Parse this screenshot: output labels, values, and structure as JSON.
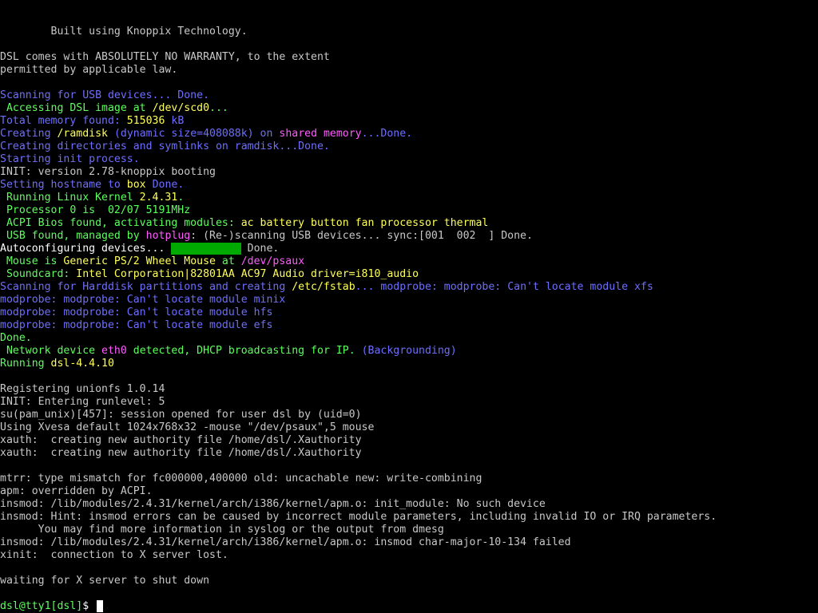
{
  "terminal": {
    "lines": [
      [
        {
          "t": "        Built using Knoppix Technology.",
          "c": "white"
        }
      ],
      [],
      [
        {
          "t": "DSL comes with ABSOLUTELY NO WARRANTY, to the extent",
          "c": "white"
        }
      ],
      [
        {
          "t": "permitted by applicable law.",
          "c": "white"
        }
      ],
      [],
      [
        {
          "t": "Scanning for USB devices... Done.",
          "c": "blue"
        }
      ],
      [
        {
          "t": " Accessing DSL image at ",
          "c": "green"
        },
        {
          "t": "/dev/scd0",
          "c": "yellow"
        },
        {
          "t": "...",
          "c": "green"
        }
      ],
      [
        {
          "t": "Total memory found: ",
          "c": "blue"
        },
        {
          "t": "515036",
          "c": "yellow"
        },
        {
          "t": " kB",
          "c": "blue"
        }
      ],
      [
        {
          "t": "Creating ",
          "c": "blue"
        },
        {
          "t": "/ramdisk",
          "c": "yellow"
        },
        {
          "t": " (dynamic size=408088k) on ",
          "c": "blue"
        },
        {
          "t": "shared memory",
          "c": "magenta"
        },
        {
          "t": "...Done.",
          "c": "blue"
        }
      ],
      [
        {
          "t": "Creating directories and symlinks on ramdisk...Done.",
          "c": "blue"
        }
      ],
      [
        {
          "t": "Starting init process.",
          "c": "blue"
        }
      ],
      [
        {
          "t": "INIT: version 2.78-knoppix booting",
          "c": "white"
        }
      ],
      [
        {
          "t": "Setting hostname to ",
          "c": "blue"
        },
        {
          "t": "box",
          "c": "yellow"
        },
        {
          "t": " Done.",
          "c": "blue"
        }
      ],
      [
        {
          "t": " Running Linux Kernel ",
          "c": "green"
        },
        {
          "t": "2.4.31",
          "c": "yellow"
        },
        {
          "t": ".",
          "c": "green"
        }
      ],
      [
        {
          "t": " Processor 0 is  02/07 5191MHz",
          "c": "green"
        }
      ],
      [
        {
          "t": " ACPI Bios found, activating modules: ",
          "c": "green"
        },
        {
          "t": "ac battery button fan processor thermal",
          "c": "yellow"
        }
      ],
      [
        {
          "t": " USB found, managed by ",
          "c": "green"
        },
        {
          "t": "hotplug",
          "c": "magenta"
        },
        {
          "t": ": (Re-)scanning USB devices... sync:[001  002  ] Done.",
          "c": "white"
        }
      ],
      [
        {
          "t": "Autoconfiguring devices... ",
          "c": "bright"
        },
        {
          "t": "           ",
          "c": "bar"
        },
        {
          "t": " Done.",
          "c": "white"
        }
      ],
      [
        {
          "t": " Mouse is ",
          "c": "green"
        },
        {
          "t": "Generic PS/2 Wheel Mouse",
          "c": "yellow"
        },
        {
          "t": " at ",
          "c": "green"
        },
        {
          "t": "/dev/psaux",
          "c": "magenta"
        }
      ],
      [
        {
          "t": " Soundcard: ",
          "c": "green"
        },
        {
          "t": "Intel Corporation|82801AA AC97 Audio driver=i810_audio",
          "c": "yellow"
        }
      ],
      [
        {
          "t": "Scanning for Harddisk partitions and creating ",
          "c": "blue"
        },
        {
          "t": "/etc/fstab",
          "c": "yellow"
        },
        {
          "t": "... modprobe: modprobe: Can't locate module xfs",
          "c": "blue"
        }
      ],
      [
        {
          "t": "modprobe: modprobe: Can't locate module minix",
          "c": "blue"
        }
      ],
      [
        {
          "t": "modprobe: modprobe: Can't locate module hfs",
          "c": "blue"
        }
      ],
      [
        {
          "t": "modprobe: modprobe: Can't locate module efs",
          "c": "blue"
        }
      ],
      [
        {
          "t": "Done.",
          "c": "green"
        }
      ],
      [
        {
          "t": " Network device ",
          "c": "green"
        },
        {
          "t": "eth0",
          "c": "magenta"
        },
        {
          "t": " detected, DHCP broadcasting for IP. ",
          "c": "green"
        },
        {
          "t": "(Backgrounding)",
          "c": "blue"
        }
      ],
      [
        {
          "t": "Running ",
          "c": "green"
        },
        {
          "t": "dsl-4.4.10",
          "c": "yellow"
        }
      ],
      [],
      [
        {
          "t": "Registering unionfs 1.0.14",
          "c": "white"
        }
      ],
      [
        {
          "t": "INIT: Entering runlevel: 5",
          "c": "white"
        }
      ],
      [
        {
          "t": "su(pam_unix)[457]: session opened for user dsl by (uid=0)",
          "c": "white"
        }
      ],
      [
        {
          "t": "Using Xvesa default 1024x768x32 -mouse \"/dev/psaux\",5 mouse",
          "c": "white"
        }
      ],
      [
        {
          "t": "xauth:  creating new authority file /home/dsl/.Xauthority",
          "c": "white"
        }
      ],
      [
        {
          "t": "xauth:  creating new authority file /home/dsl/.Xauthority",
          "c": "white"
        }
      ],
      [],
      [
        {
          "t": "mtrr: type mismatch for fc000000,400000 old: uncachable new: write-combining",
          "c": "white"
        }
      ],
      [
        {
          "t": "apm: overridden by ACPI.",
          "c": "white"
        }
      ],
      [
        {
          "t": "insmod: /lib/modules/2.4.31/kernel/arch/i386/kernel/apm.o: init_module: No such device",
          "c": "white"
        }
      ],
      [
        {
          "t": "insmod: Hint: insmod errors can be caused by incorrect module parameters, including invalid IO or IRQ parameters.",
          "c": "white"
        }
      ],
      [
        {
          "t": "      You may find more information in syslog or the output from dmesg",
          "c": "white"
        }
      ],
      [
        {
          "t": "insmod: /lib/modules/2.4.31/kernel/arch/i386/kernel/apm.o: insmod char-major-10-134 failed",
          "c": "white"
        }
      ],
      [
        {
          "t": "xinit:  connection to X server lost.",
          "c": "white"
        }
      ],
      [],
      [
        {
          "t": "waiting for X server to shut down",
          "c": "white"
        }
      ],
      []
    ],
    "prompt": {
      "user": "dsl@tty1",
      "path": "[dsl]",
      "symbol": "$ "
    }
  },
  "colors": {
    "background": "#000000",
    "white": "#c8c8c8",
    "blue": "#6e6eff",
    "green": "#5cff5c",
    "yellow": "#ffff5c",
    "magenta": "#ff5cff",
    "bar": "#00aa00"
  }
}
